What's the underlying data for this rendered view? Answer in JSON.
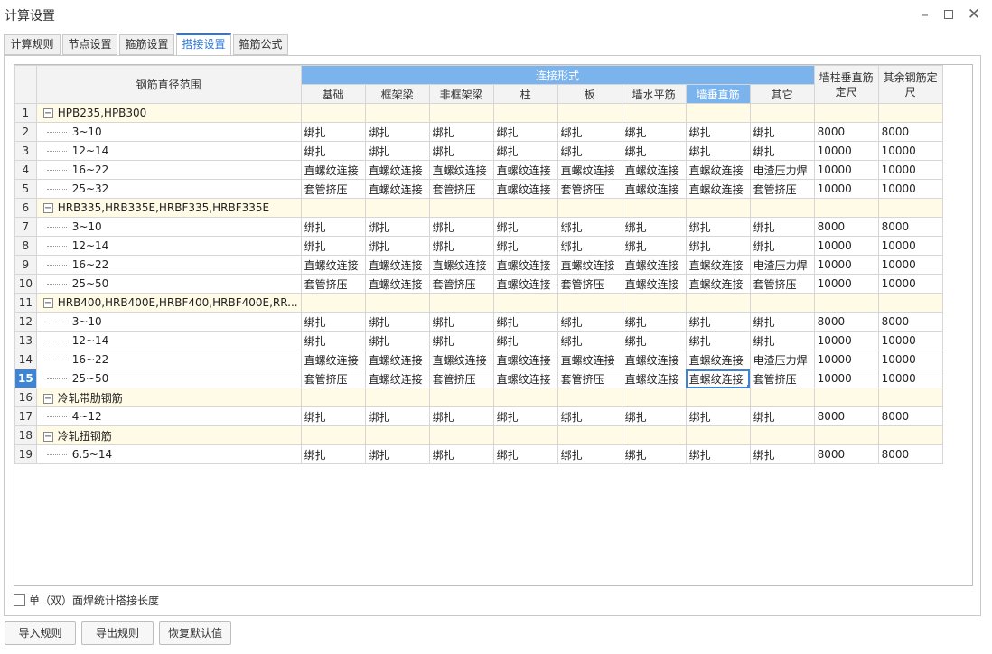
{
  "window": {
    "title": "计算设置",
    "minimize": "–",
    "close": "✕"
  },
  "tabs": [
    "计算规则",
    "节点设置",
    "箍筋设置",
    "搭接设置",
    "箍筋公式"
  ],
  "active_tab": "搭接设置",
  "grid": {
    "header_range": "钢筋直径范围",
    "header_group": "连接形式",
    "connection_columns": [
      "基础",
      "框架梁",
      "非框架梁",
      "柱",
      "板",
      "墙水平筋",
      "墙垂直筋",
      "其它"
    ],
    "header_wall_vertical_length": "墙柱垂直筋定尺",
    "header_other_length": "其余钢筋定尺",
    "rows": [
      {
        "num": "1",
        "group": true,
        "label": "HPB235,HPB300"
      },
      {
        "num": "2",
        "label": "3~10",
        "cells": [
          "绑扎",
          "绑扎",
          "绑扎",
          "绑扎",
          "绑扎",
          "绑扎",
          "绑扎",
          "绑扎",
          "8000",
          "8000"
        ]
      },
      {
        "num": "3",
        "label": "12~14",
        "cells": [
          "绑扎",
          "绑扎",
          "绑扎",
          "绑扎",
          "绑扎",
          "绑扎",
          "绑扎",
          "绑扎",
          "10000",
          "10000"
        ]
      },
      {
        "num": "4",
        "label": "16~22",
        "cells": [
          "直螺纹连接",
          "直螺纹连接",
          "直螺纹连接",
          "直螺纹连接",
          "直螺纹连接",
          "直螺纹连接",
          "直螺纹连接",
          "电渣压力焊",
          "10000",
          "10000"
        ]
      },
      {
        "num": "5",
        "label": "25~32",
        "cells": [
          "套管挤压",
          "直螺纹连接",
          "套管挤压",
          "直螺纹连接",
          "套管挤压",
          "直螺纹连接",
          "直螺纹连接",
          "套管挤压",
          "10000",
          "10000"
        ]
      },
      {
        "num": "6",
        "group": true,
        "label": "HRB335,HRB335E,HRBF335,HRBF335E"
      },
      {
        "num": "7",
        "label": "3~10",
        "cells": [
          "绑扎",
          "绑扎",
          "绑扎",
          "绑扎",
          "绑扎",
          "绑扎",
          "绑扎",
          "绑扎",
          "8000",
          "8000"
        ]
      },
      {
        "num": "8",
        "label": "12~14",
        "cells": [
          "绑扎",
          "绑扎",
          "绑扎",
          "绑扎",
          "绑扎",
          "绑扎",
          "绑扎",
          "绑扎",
          "10000",
          "10000"
        ]
      },
      {
        "num": "9",
        "label": "16~22",
        "cells": [
          "直螺纹连接",
          "直螺纹连接",
          "直螺纹连接",
          "直螺纹连接",
          "直螺纹连接",
          "直螺纹连接",
          "直螺纹连接",
          "电渣压力焊",
          "10000",
          "10000"
        ]
      },
      {
        "num": "10",
        "label": "25~50",
        "cells": [
          "套管挤压",
          "直螺纹连接",
          "套管挤压",
          "直螺纹连接",
          "套管挤压",
          "直螺纹连接",
          "直螺纹连接",
          "套管挤压",
          "10000",
          "10000"
        ]
      },
      {
        "num": "11",
        "group": true,
        "label": "HRB400,HRB400E,HRBF400,HRBF400E,RR..."
      },
      {
        "num": "12",
        "label": "3~10",
        "cells": [
          "绑扎",
          "绑扎",
          "绑扎",
          "绑扎",
          "绑扎",
          "绑扎",
          "绑扎",
          "绑扎",
          "8000",
          "8000"
        ]
      },
      {
        "num": "13",
        "label": "12~14",
        "cells": [
          "绑扎",
          "绑扎",
          "绑扎",
          "绑扎",
          "绑扎",
          "绑扎",
          "绑扎",
          "绑扎",
          "10000",
          "10000"
        ]
      },
      {
        "num": "14",
        "label": "16~22",
        "cells": [
          "直螺纹连接",
          "直螺纹连接",
          "直螺纹连接",
          "直螺纹连接",
          "直螺纹连接",
          "直螺纹连接",
          "直螺纹连接",
          "电渣压力焊",
          "10000",
          "10000"
        ]
      },
      {
        "num": "15",
        "label": "25~50",
        "selected": true,
        "cells": [
          "套管挤压",
          "直螺纹连接",
          "套管挤压",
          "直螺纹连接",
          "套管挤压",
          "直螺纹连接",
          "直螺纹连接",
          "套管挤压",
          "10000",
          "10000"
        ]
      },
      {
        "num": "16",
        "group": true,
        "label": "冷轧带肋钢筋"
      },
      {
        "num": "17",
        "label": "4~12",
        "cells": [
          "绑扎",
          "绑扎",
          "绑扎",
          "绑扎",
          "绑扎",
          "绑扎",
          "绑扎",
          "绑扎",
          "8000",
          "8000"
        ]
      },
      {
        "num": "18",
        "group": true,
        "label": "冷轧扭钢筋"
      },
      {
        "num": "19",
        "label": "6.5~14",
        "cells": [
          "绑扎",
          "绑扎",
          "绑扎",
          "绑扎",
          "绑扎",
          "绑扎",
          "绑扎",
          "绑扎",
          "8000",
          "8000"
        ]
      }
    ]
  },
  "weld_option": {
    "label": "单（双）面焊统计搭接长度",
    "checked": false
  },
  "buttons": {
    "import": "导入规则",
    "export": "导出规则",
    "restore": "恢复默认值"
  },
  "colors": {
    "accent": "#2b78d9",
    "header_blue": "#7bb4ec",
    "group_row": "#fffbe6",
    "selected_row_number": "#3d85d4"
  }
}
